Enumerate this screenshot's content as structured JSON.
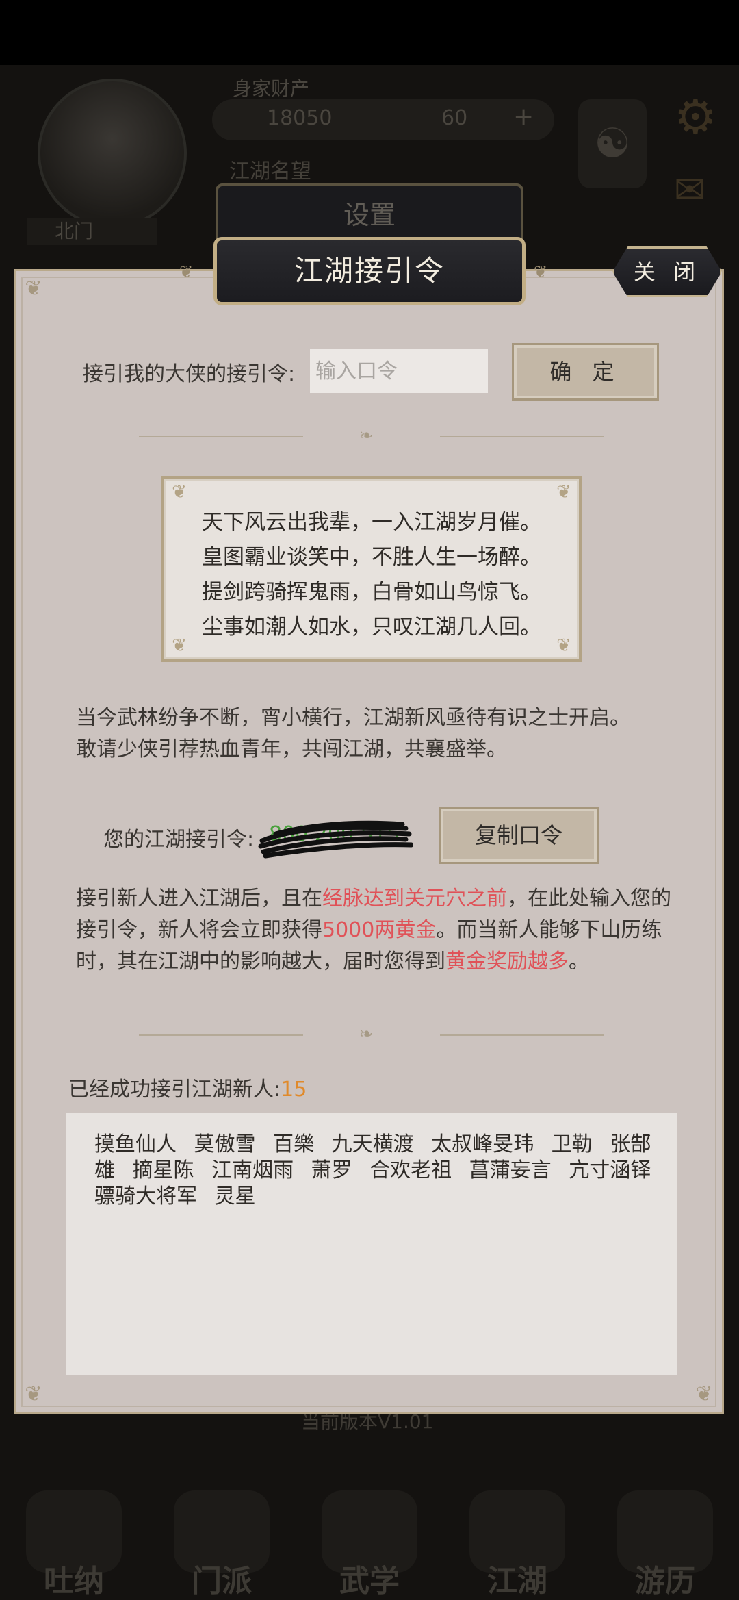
{
  "background": {
    "resource_label": "身家财产",
    "gold": "18050",
    "jade": "60",
    "fame_label": "江湖名望",
    "player_name": "北门",
    "version": "当前版本V1.01",
    "nav": [
      "吐纳",
      "门派",
      "武学",
      "江湖",
      "游历"
    ]
  },
  "settings_tab": {
    "label": "设置"
  },
  "dialog": {
    "title": "江湖接引令",
    "close_label": "关 闭",
    "invite_label": "接引我的大侠的接引令:",
    "invite_placeholder": "输入口令",
    "confirm_label": "确 定",
    "poem": [
      "天下风云出我辈，一入江湖岁月催。",
      "皇图霸业谈笑中，不胜人生一场醉。",
      "提剑跨骑挥鬼雨，白骨如山鸟惊飞。",
      "尘事如潮人如水，只叹江湖几人回。"
    ],
    "intro": [
      "当今武林纷争不断，宵小横行，江湖新风亟待有识之士开启。",
      "敢请少侠引荐热血青年，共闯江湖，共襄盛举。"
    ],
    "my_code_label": "您的江湖接引令:",
    "my_code_value": "800 200 515",
    "copy_label": "复制口令",
    "rules": {
      "p1": "接引新人进入江湖后，且在",
      "h1": "经脉达到关元穴之前",
      "p2": "，在此处输入您的接引令，新人将会立即获得",
      "h2": "5000两黄金",
      "p3": "。而当新人能够下山历练时，其在江湖中的影响越大，届时您得到",
      "h3": "黄金奖励越多",
      "p4": "。"
    },
    "count_label": "已经成功接引江湖新人:",
    "count_value": "15",
    "names": "摸鱼仙人 莫傲雪 百樂 九天横渡 太叔峰旻玮 卫勒 张郜雄 摘星陈 江南烟雨 萧罗 合欢老祖 菖蒲妄言 亢寸涵铎 骠骑大将军 灵星"
  },
  "colors": {
    "dialog_bg": "#ccc3bf",
    "tab_bg": "#1c1c20",
    "gold_border": "#c2ae85",
    "highlight_red": "#e05258",
    "count_orange": "#e08a2b",
    "code_green": "#4aa13d"
  }
}
